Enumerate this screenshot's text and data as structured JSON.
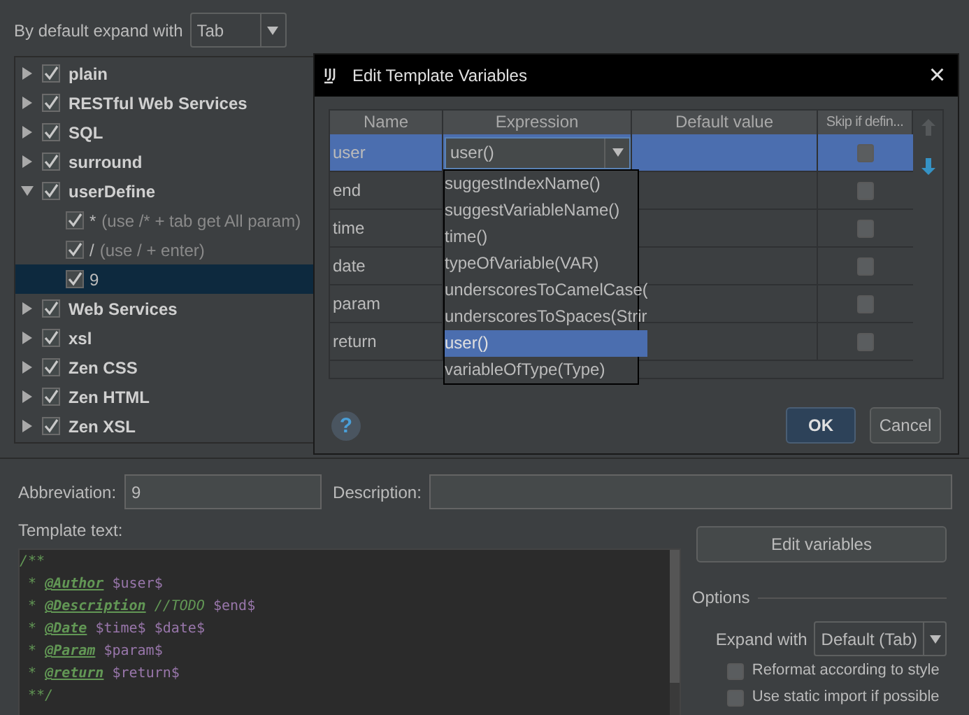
{
  "expand_default": {
    "label": "By default expand with",
    "value": "Tab"
  },
  "tree": [
    {
      "name": "plain",
      "checked": true,
      "expanded": false,
      "selected": false
    },
    {
      "name": "RESTful Web Services",
      "checked": true,
      "expanded": false,
      "selected": false
    },
    {
      "name": "SQL",
      "checked": true,
      "expanded": false,
      "selected": false
    },
    {
      "name": "surround",
      "checked": true,
      "expanded": false,
      "selected": false
    },
    {
      "name": "userDefine",
      "checked": true,
      "expanded": true,
      "selected": false,
      "children": [
        {
          "name": "*",
          "description": "(use /* + tab get All param)",
          "checked": true,
          "selected": false
        },
        {
          "name": "/",
          "description": "(use / + enter)",
          "checked": true,
          "selected": false
        },
        {
          "name": "9",
          "checked": true,
          "selected": true
        }
      ]
    },
    {
      "name": "Web Services",
      "checked": true,
      "expanded": false,
      "selected": false
    },
    {
      "name": "xsl",
      "checked": true,
      "expanded": false,
      "selected": false
    },
    {
      "name": "Zen CSS",
      "checked": true,
      "expanded": false,
      "selected": false
    },
    {
      "name": "Zen HTML",
      "checked": true,
      "expanded": false,
      "selected": false
    },
    {
      "name": "Zen XSL",
      "checked": true,
      "expanded": false,
      "selected": false
    }
  ],
  "abbreviation": {
    "label": "Abbreviation:",
    "value": "9"
  },
  "description": {
    "label": "Description:"
  },
  "template_text": {
    "label": "Template text:",
    "lines": [
      [
        {
          "kind": "comment",
          "text": "/**"
        }
      ],
      [
        {
          "kind": "comment",
          "text": " * "
        },
        {
          "kind": "tag",
          "text": "@Author"
        },
        {
          "kind": "variable",
          "text": " $user$"
        }
      ],
      [
        {
          "kind": "comment",
          "text": " * "
        },
        {
          "kind": "tag",
          "text": "@Description"
        },
        {
          "kind": "todo",
          "text": " //TODO"
        },
        {
          "kind": "variable",
          "text": " $end$"
        }
      ],
      [
        {
          "kind": "comment",
          "text": " * "
        },
        {
          "kind": "tag",
          "text": "@Date"
        },
        {
          "kind": "variable",
          "text": " $time$ $date$"
        }
      ],
      [
        {
          "kind": "comment",
          "text": " * "
        },
        {
          "kind": "tag",
          "text": "@Param"
        },
        {
          "kind": "variable",
          "text": " $param$"
        }
      ],
      [
        {
          "kind": "comment",
          "text": " * "
        },
        {
          "kind": "tag",
          "text": "@return"
        },
        {
          "kind": "variable",
          "text": " $return$"
        }
      ],
      [
        {
          "kind": "comment",
          "text": " **/"
        }
      ]
    ]
  },
  "edit_variables_button": "Edit variables",
  "options": {
    "title": "Options",
    "expand_with": {
      "label": "Expand with",
      "value": "Default (Tab)"
    },
    "checkboxes": [
      {
        "label": "Reformat according to style",
        "checked": false
      },
      {
        "label": "Use static import if possible",
        "checked": false
      }
    ]
  },
  "dialog": {
    "title": "Edit Template Variables",
    "close": "×",
    "columns": [
      "Name",
      "Expression",
      "Default value",
      "Skip if defin..."
    ],
    "rows": [
      {
        "name": "user",
        "expression": "user()",
        "selected": true,
        "skip": false
      },
      {
        "name": "end",
        "selected": false,
        "skip": false
      },
      {
        "name": "time",
        "selected": false,
        "skip": false
      },
      {
        "name": "date",
        "selected": false,
        "skip": false
      },
      {
        "name": "param",
        "selected": false,
        "skip": false
      },
      {
        "name": "return",
        "selected": false,
        "skip": false
      }
    ],
    "move_up": {
      "disabled": true
    },
    "move_down": {
      "disabled": false
    },
    "dropdown": [
      {
        "label": "suggestIndexName()",
        "selected": false
      },
      {
        "label": "suggestVariableName()",
        "selected": false
      },
      {
        "label": "time()",
        "selected": false
      },
      {
        "label": "typeOfVariable(VAR)",
        "selected": false
      },
      {
        "label": "underscoresToCamelCase(",
        "selected": false
      },
      {
        "label": "underscoresToSpaces(Strir",
        "selected": false
      },
      {
        "label": "user()",
        "selected": true
      },
      {
        "label": "variableOfType(Type)",
        "selected": false
      }
    ],
    "help": "?",
    "ok": "OK",
    "cancel": "Cancel"
  }
}
